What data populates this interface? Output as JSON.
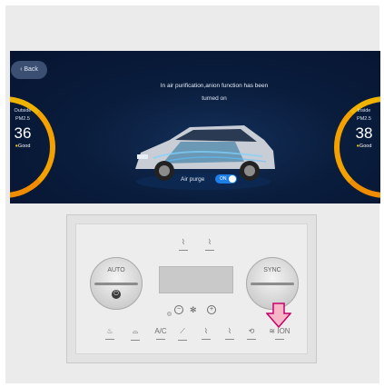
{
  "screen": {
    "back_label": "Back",
    "message_line1": "In air purification,anion function has been",
    "message_line2": "turned on",
    "outside": {
      "label1": "Outside",
      "label2": "PM2.5",
      "value": "36",
      "quality": "Good"
    },
    "inside": {
      "label1": "Inside",
      "label2": "PM2.5",
      "value": "38",
      "quality": "Good"
    },
    "purge_label": "Air purge",
    "toggle_label": "ON",
    "colors": {
      "gauge": "#f4a100",
      "toggle": "#1d7ee8",
      "bg": "#0a1d3d"
    }
  },
  "panel": {
    "auto_label": "AUTO",
    "sync_label": "SYNC",
    "ac_label": "A/C",
    "ion_label": "ION",
    "fan_minus": "−",
    "fan_plus": "+",
    "fan_icon": "fan-icon"
  }
}
